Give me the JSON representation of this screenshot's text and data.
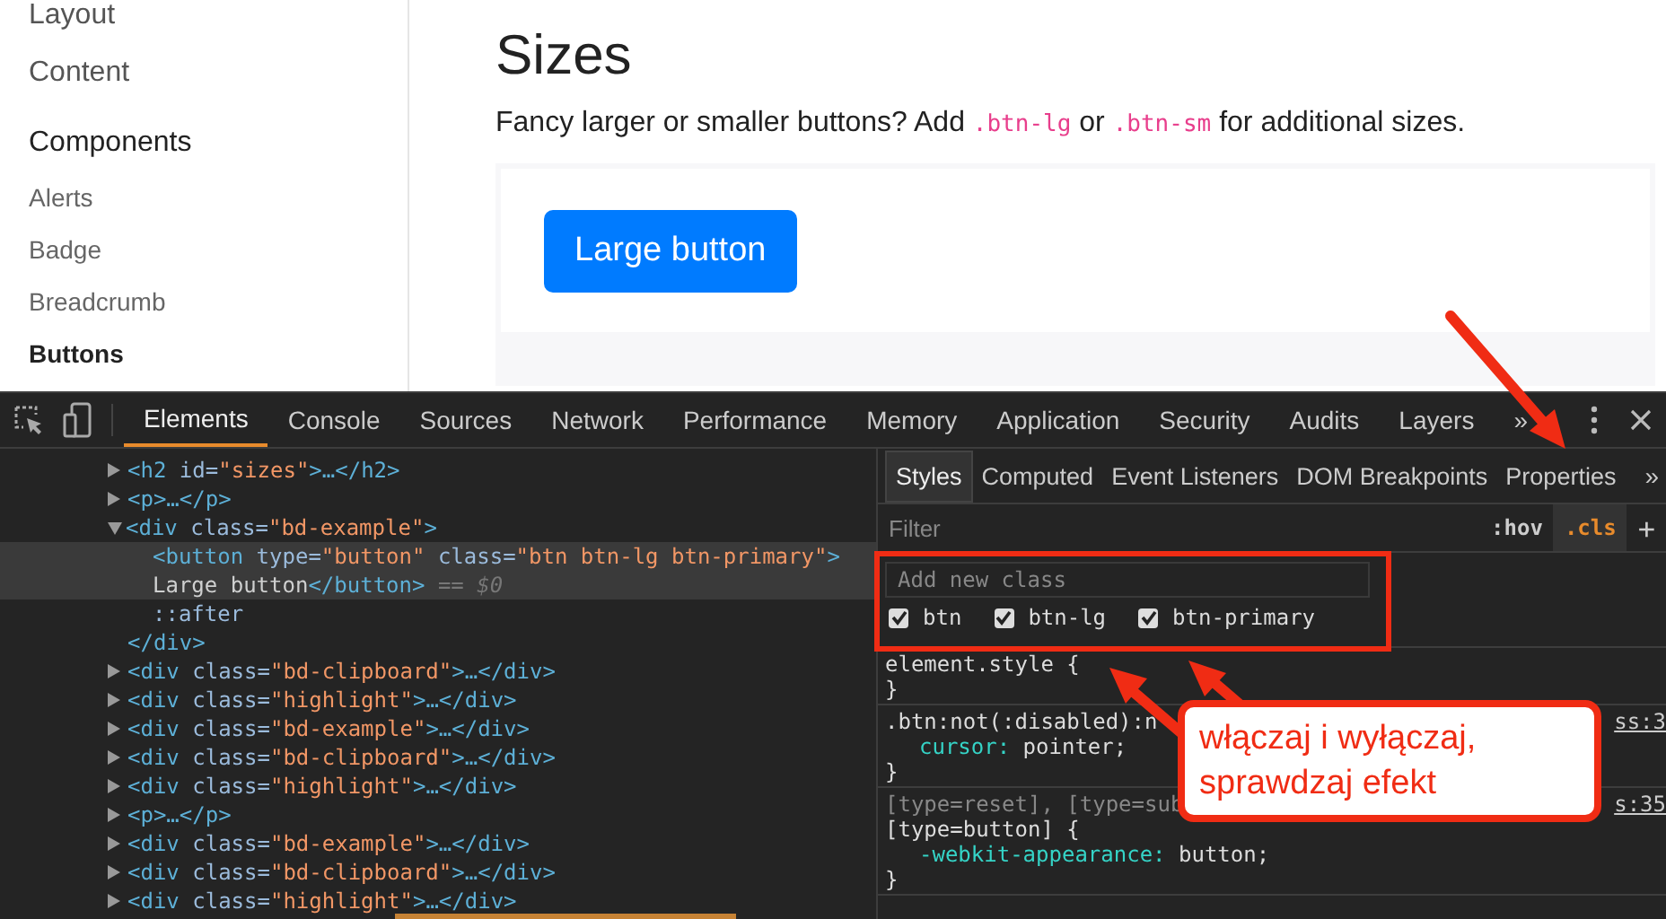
{
  "page": {
    "sidebar": {
      "groups": [
        {
          "items": [
            {
              "label": "Layout",
              "selected": false
            },
            {
              "label": "Content",
              "selected": false
            }
          ]
        },
        {
          "heading": "Components",
          "items": [
            {
              "label": "Alerts",
              "selected": false
            },
            {
              "label": "Badge",
              "selected": false
            },
            {
              "label": "Breadcrumb",
              "selected": false
            },
            {
              "label": "Buttons",
              "selected": true
            }
          ]
        }
      ]
    },
    "content": {
      "title": "Sizes",
      "paragraph": [
        {
          "kind": "text",
          "text": "Fancy larger or smaller buttons? Add "
        },
        {
          "kind": "code",
          "text": ".btn-lg"
        },
        {
          "kind": "text",
          "text": " or "
        },
        {
          "kind": "code",
          "text": ".btn-sm"
        },
        {
          "kind": "text",
          "text": " for additional sizes."
        }
      ],
      "example_button": "Large button"
    }
  },
  "devtools": {
    "tabs": [
      {
        "label": "Elements",
        "selected": true
      },
      {
        "label": "Console",
        "selected": false
      },
      {
        "label": "Sources",
        "selected": false
      },
      {
        "label": "Network",
        "selected": false
      },
      {
        "label": "Performance",
        "selected": false
      },
      {
        "label": "Memory",
        "selected": false
      },
      {
        "label": "Application",
        "selected": false
      },
      {
        "label": "Security",
        "selected": false
      },
      {
        "label": "Audits",
        "selected": false
      },
      {
        "label": "Layers",
        "selected": false
      }
    ],
    "more": "»",
    "tree": [
      {
        "expanded": false,
        "selected": false,
        "lines": [
          [
            {
              "kind": "tag",
              "s": "<h2 "
            },
            {
              "kind": "attr",
              "s": "id="
            },
            {
              "kind": "value",
              "s": "\"sizes\""
            },
            {
              "kind": "tag",
              "s": ">…</h2>"
            }
          ]
        ]
      },
      {
        "expanded": false,
        "selected": false,
        "lines": [
          [
            {
              "kind": "tag",
              "s": "<p>…</p>"
            }
          ]
        ]
      },
      {
        "expanded": true,
        "selected": false,
        "lines": [
          [
            {
              "kind": "tag",
              "s": "<div "
            },
            {
              "kind": "attr",
              "s": "class="
            },
            {
              "kind": "value",
              "s": "\"bd-example\""
            },
            {
              "kind": "tag",
              "s": ">"
            }
          ]
        ],
        "close": [
          {
            "kind": "tag",
            "s": "</div>"
          }
        ],
        "children": [
          {
            "selected": true,
            "lines": [
              [
                {
                  "kind": "tag",
                  "s": "<button "
                },
                {
                  "kind": "attr",
                  "s": "type="
                },
                {
                  "kind": "value",
                  "s": "\"button\""
                },
                {
                  "kind": "attr",
                  "s": " class="
                },
                {
                  "kind": "value",
                  "s": "\"btn btn-lg btn-primary\""
                },
                {
                  "kind": "tag",
                  "s": ">"
                }
              ],
              [
                {
                  "kind": "text",
                  "s": "Large button"
                },
                {
                  "kind": "tag",
                  "s": "</button>"
                },
                {
                  "kind": "muted",
                  "s": " == $0"
                }
              ]
            ]
          },
          {
            "selected": false,
            "lines": [
              [
                {
                  "kind": "attr",
                  "s": "::after"
                }
              ]
            ]
          }
        ]
      },
      {
        "expanded": false,
        "selected": false,
        "lines": [
          [
            {
              "kind": "tag",
              "s": "<div "
            },
            {
              "kind": "attr",
              "s": "class="
            },
            {
              "kind": "value",
              "s": "\"bd-clipboard\""
            },
            {
              "kind": "tag",
              "s": ">…</div>"
            }
          ]
        ]
      },
      {
        "expanded": false,
        "selected": false,
        "lines": [
          [
            {
              "kind": "tag",
              "s": "<div "
            },
            {
              "kind": "attr",
              "s": "class="
            },
            {
              "kind": "value",
              "s": "\"highlight\""
            },
            {
              "kind": "tag",
              "s": ">…</div>"
            }
          ]
        ]
      },
      {
        "expanded": false,
        "selected": false,
        "lines": [
          [
            {
              "kind": "tag",
              "s": "<div "
            },
            {
              "kind": "attr",
              "s": "class="
            },
            {
              "kind": "value",
              "s": "\"bd-example\""
            },
            {
              "kind": "tag",
              "s": ">…</div>"
            }
          ]
        ]
      },
      {
        "expanded": false,
        "selected": false,
        "lines": [
          [
            {
              "kind": "tag",
              "s": "<div "
            },
            {
              "kind": "attr",
              "s": "class="
            },
            {
              "kind": "value",
              "s": "\"bd-clipboard\""
            },
            {
              "kind": "tag",
              "s": ">…</div>"
            }
          ]
        ]
      },
      {
        "expanded": false,
        "selected": false,
        "lines": [
          [
            {
              "kind": "tag",
              "s": "<div "
            },
            {
              "kind": "attr",
              "s": "class="
            },
            {
              "kind": "value",
              "s": "\"highlight\""
            },
            {
              "kind": "tag",
              "s": ">…</div>"
            }
          ]
        ]
      },
      {
        "expanded": false,
        "selected": false,
        "lines": [
          [
            {
              "kind": "tag",
              "s": "<p>…</p>"
            }
          ]
        ]
      },
      {
        "expanded": false,
        "selected": false,
        "lines": [
          [
            {
              "kind": "tag",
              "s": "<div "
            },
            {
              "kind": "attr",
              "s": "class="
            },
            {
              "kind": "value",
              "s": "\"bd-example\""
            },
            {
              "kind": "tag",
              "s": ">…</div>"
            }
          ]
        ]
      },
      {
        "expanded": false,
        "selected": false,
        "lines": [
          [
            {
              "kind": "tag",
              "s": "<div "
            },
            {
              "kind": "attr",
              "s": "class="
            },
            {
              "kind": "value",
              "s": "\"bd-clipboard\""
            },
            {
              "kind": "tag",
              "s": ">…</div>"
            }
          ]
        ]
      },
      {
        "expanded": false,
        "selected": false,
        "lines": [
          [
            {
              "kind": "tag",
              "s": "<div "
            },
            {
              "kind": "attr",
              "s": "class="
            },
            {
              "kind": "value",
              "s": "\"highlight\""
            },
            {
              "kind": "tag",
              "s": ">…</div>"
            }
          ]
        ]
      }
    ],
    "styles": {
      "tabs": [
        {
          "label": "Styles",
          "selected": true
        },
        {
          "label": "Computed",
          "selected": false
        },
        {
          "label": "Event Listeners",
          "selected": false
        },
        {
          "label": "DOM Breakpoints",
          "selected": false
        },
        {
          "label": "Properties",
          "selected": false
        }
      ],
      "more": "»",
      "filter": {
        "placeholder": "Filter"
      },
      "hov": ":hov",
      "cls": {
        "label": ".cls",
        "active": true
      },
      "add": "+",
      "class_panel": {
        "placeholder": "Add new class",
        "classes": [
          {
            "name": "btn",
            "checked": true
          },
          {
            "name": "btn-lg",
            "checked": true
          },
          {
            "name": "btn-primary",
            "checked": true
          }
        ]
      },
      "rules": [
        {
          "lines": [
            {
              "kind": "selector",
              "text": "element.style {"
            },
            {
              "kind": "brace",
              "text": "}"
            }
          ]
        },
        {
          "source": "ss:3",
          "lines": [
            {
              "kind": "selector",
              "text": ".btn:not(:disabled):n"
            },
            {
              "kind": "property",
              "name": "cursor:",
              "value": "pointer;"
            },
            {
              "kind": "brace",
              "text": "}"
            }
          ]
        },
        {
          "source": "s:35",
          "lines": [
            {
              "kind": "muted",
              "text": "[type=reset], [type=sub"
            },
            {
              "kind": "selector",
              "text": "[type=button] {"
            },
            {
              "kind": "property",
              "name": "-webkit-appearance:",
              "value": "button;"
            },
            {
              "kind": "brace",
              "text": "}"
            }
          ]
        }
      ]
    }
  },
  "annotation": {
    "lines": [
      "włączaj i wyłączaj,",
      "sprawdzaj efekt"
    ]
  }
}
